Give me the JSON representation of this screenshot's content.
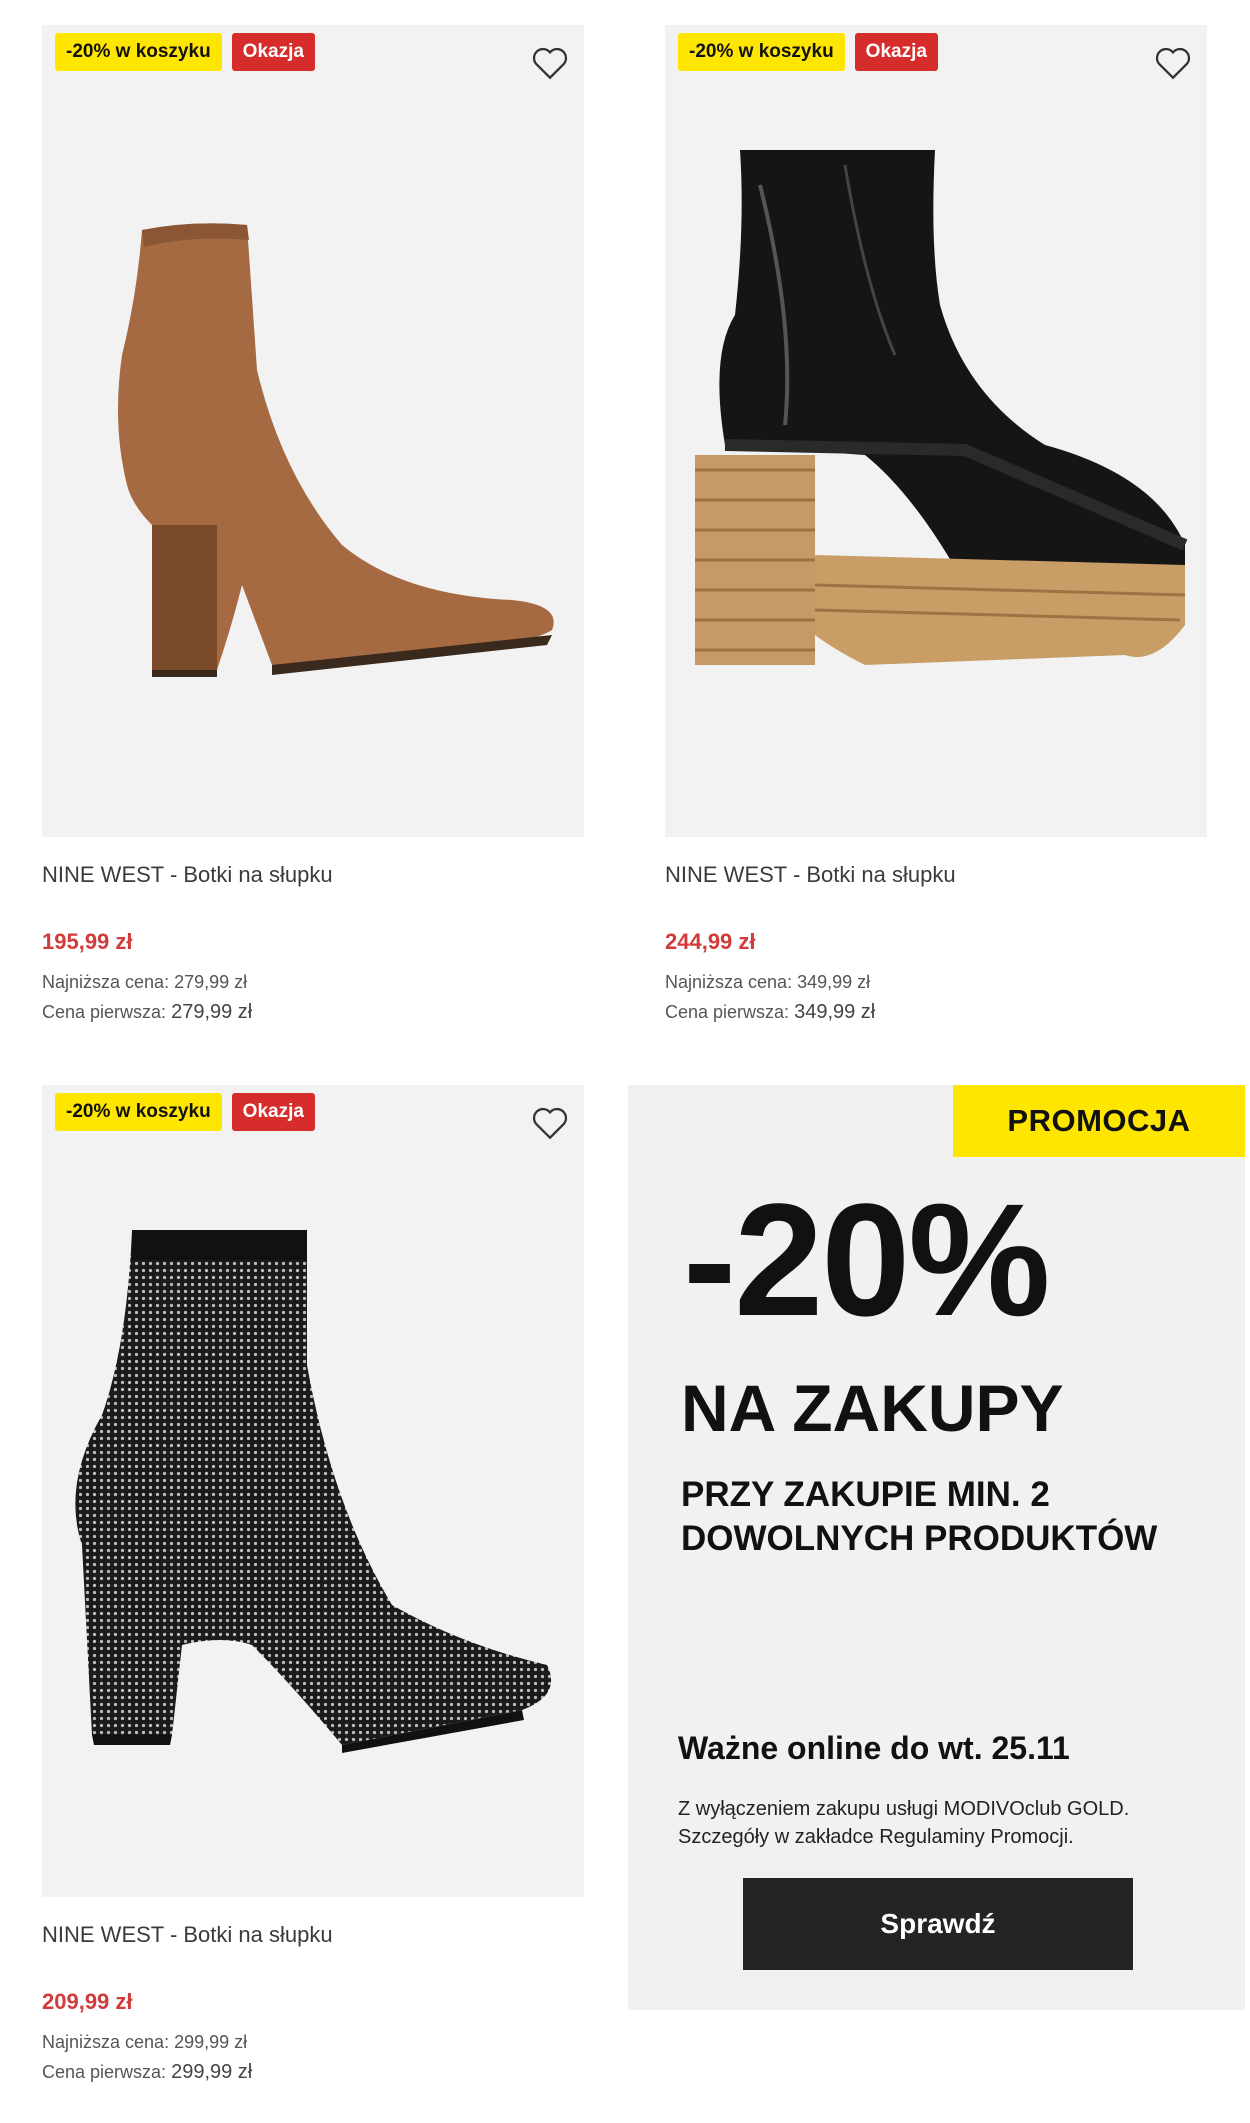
{
  "products": [
    {
      "badge_discount": "-20% w koszyku",
      "badge_deal": "Okazja",
      "name": "NINE WEST - Botki na słupku",
      "price": "195,99 zł",
      "lowest_label": "Najniższa cena:",
      "lowest_value": "279,99 zł",
      "first_label": "Cena pierwsza:",
      "first_value": "279,99 zł",
      "image": "brown-suede-ankle-boot"
    },
    {
      "badge_discount": "-20% w koszyku",
      "badge_deal": "Okazja",
      "name": "NINE WEST - Botki na słupku",
      "price": "244,99 zł",
      "lowest_label": "Najniższa cena:",
      "lowest_value": "349,99 zł",
      "first_label": "Cena pierwsza:",
      "first_value": "349,99 zł",
      "image": "black-patent-platform-boot"
    },
    {
      "badge_discount": "-20% w koszyku",
      "badge_deal": "Okazja",
      "name": "NINE WEST - Botki na słupku",
      "price": "209,99 zł",
      "lowest_label": "Najniższa cena:",
      "lowest_value": "299,99 zł",
      "first_label": "Cena pierwsza:",
      "first_value": "299,99 zł",
      "image": "black-studded-sock-boot"
    }
  ],
  "promo": {
    "badge": "PROMOCJA",
    "big": "-20%",
    "headline": "NA ZAKUPY",
    "sub_line1": "PRZY ZAKUPIE MIN. 2",
    "sub_line2": "DOWOLNYCH PRODUKTÓW",
    "valid": "Ważne online do wt. 25.11",
    "note_line1": "Z wyłączeniem zakupu usługi MODIVOclub GOLD.",
    "note_line2": "Szczegóły w zakładce Regulaminy Promocji.",
    "button": "Sprawdź"
  },
  "colors": {
    "badge_yellow": "#ffe600",
    "badge_red": "#d72c2c",
    "price_red": "#d13b3b",
    "button_dark": "#242424"
  },
  "icons": [
    "heart-icon"
  ]
}
